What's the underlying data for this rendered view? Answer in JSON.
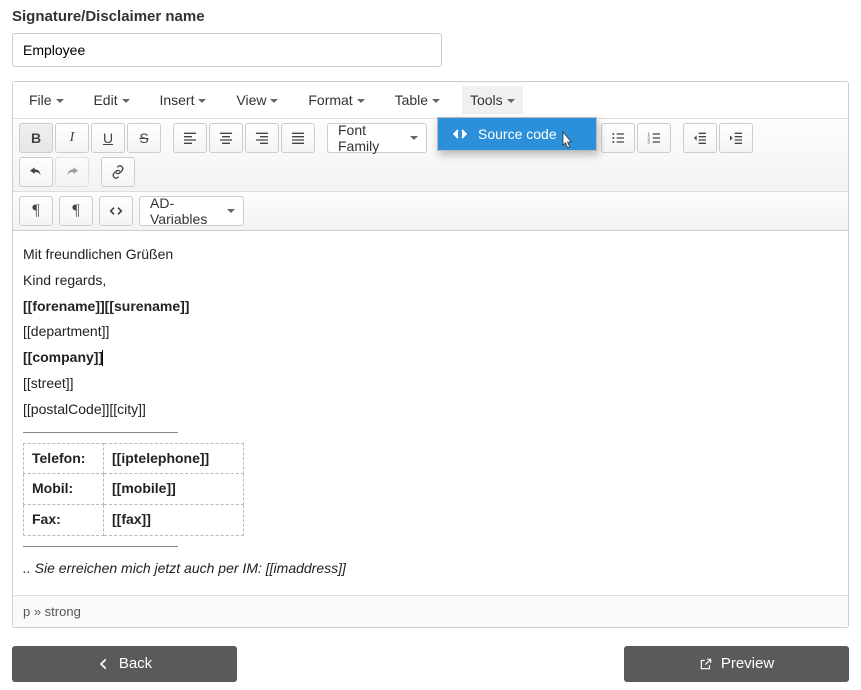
{
  "header": {
    "label": "Signature/Disclaimer name"
  },
  "name_input": {
    "value": "Employee",
    "placeholder": ""
  },
  "menubar": {
    "items": [
      {
        "label": "File"
      },
      {
        "label": "Edit"
      },
      {
        "label": "Insert"
      },
      {
        "label": "View"
      },
      {
        "label": "Format"
      },
      {
        "label": "Table"
      },
      {
        "label": "Tools"
      }
    ]
  },
  "toolbar": {
    "font_family_label": "Font Family",
    "ad_variables_label": "AD-Variables"
  },
  "tools_dropdown": {
    "source_code": "Source code"
  },
  "content": {
    "line1": "Mit freundlichen Grüßen",
    "line2": "Kind regards,",
    "line3": "[[forename]][[surename]]",
    "line4": "[[department]]",
    "line5": "[[company]]",
    "line6": "[[street]]",
    "line7": "[[postalCode]][[city]]",
    "table": [
      {
        "label": "Telefon:",
        "value": "[[iptelephone]]"
      },
      {
        "label": "Mobil:",
        "value": "[[mobile]]"
      },
      {
        "label": "Fax:",
        "value": "[[fax]]"
      }
    ],
    "line8": ".. Sie erreichen mich jetzt auch per IM: [[imaddress]]"
  },
  "path_bar": "p » strong",
  "footer": {
    "back": "Back",
    "preview": "Preview"
  }
}
